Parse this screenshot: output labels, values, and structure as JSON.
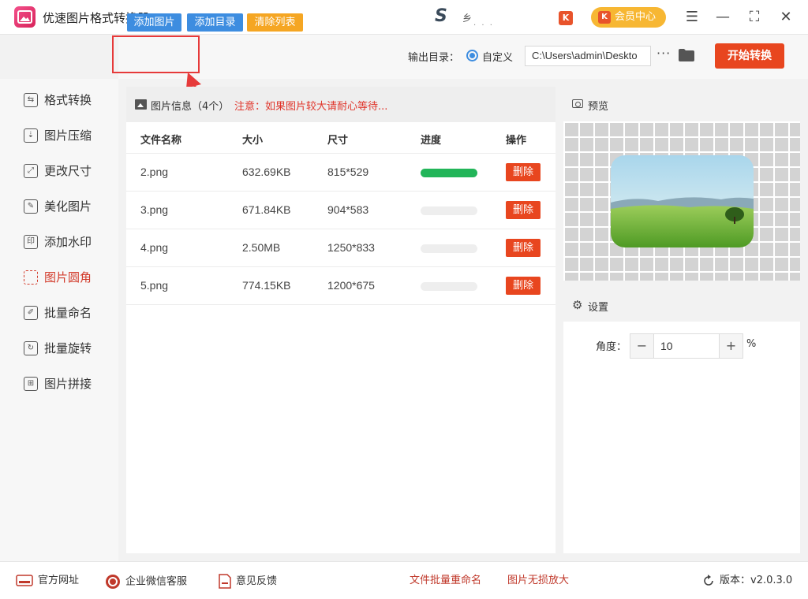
{
  "app": {
    "title": "优速图片格式转换器",
    "brand_sub": "乡",
    "member_label": "会员中心",
    "k_badge": "K"
  },
  "window": {
    "menu": "☰",
    "minimize": "—",
    "maximize": "⛶",
    "close": "✕"
  },
  "toolbar": {
    "add_image": "添加图片",
    "add_folder": "添加目录",
    "clear_list": "清除列表",
    "output_label": "输出目录：",
    "custom_label": "自定义",
    "output_path": "C:\\Users\\admin\\Deskto",
    "more": "···",
    "start_button": "开始转换"
  },
  "sidebar": {
    "items": [
      {
        "label": "格式转换",
        "icon": "format-icon",
        "glyph": "⇆",
        "active": false
      },
      {
        "label": "图片压缩",
        "icon": "compress-icon",
        "glyph": "⇣",
        "active": false
      },
      {
        "label": "更改尺寸",
        "icon": "resize-icon",
        "glyph": "⤢",
        "active": false
      },
      {
        "label": "美化图片",
        "icon": "beautify-icon",
        "glyph": "✎",
        "active": false
      },
      {
        "label": "添加水印",
        "icon": "watermark-icon",
        "glyph": "印",
        "active": false
      },
      {
        "label": "图片圆角",
        "icon": "rounded-corner-icon",
        "glyph": "",
        "active": true
      },
      {
        "label": "批量命名",
        "icon": "rename-icon",
        "glyph": "✐",
        "active": false
      },
      {
        "label": "批量旋转",
        "icon": "rotate-icon",
        "glyph": "↻",
        "active": false
      },
      {
        "label": "图片拼接",
        "icon": "stitch-icon",
        "glyph": "⊞",
        "active": false
      }
    ]
  },
  "file_list": {
    "info_label": "图片信息（4个）",
    "notice": "注意：如果图片较大请耐心等待...",
    "columns": [
      "文件名称",
      "大小",
      "尺寸",
      "进度",
      "操作"
    ],
    "delete_label": "删除",
    "rows": [
      {
        "name": "2.png",
        "size": "632.69KB",
        "dimensions": "815*529",
        "progress": 1.0
      },
      {
        "name": "3.png",
        "size": "671.84KB",
        "dimensions": "904*583",
        "progress": 0
      },
      {
        "name": "4.png",
        "size": "2.50MB",
        "dimensions": "1250*833",
        "progress": 0
      },
      {
        "name": "5.png",
        "size": "774.15KB",
        "dimensions": "1200*675",
        "progress": 0
      }
    ]
  },
  "preview": {
    "label": "预览"
  },
  "settings": {
    "label": "设置",
    "angle_label": "角度：",
    "angle_value": "10",
    "minus": "−",
    "plus": "+",
    "unit": "%"
  },
  "footer": {
    "website": "官方网址",
    "wechat": "企业微信客服",
    "feedback": "意见反馈",
    "batch_rename": "文件批量重命名",
    "lossless": "图片无损放大",
    "version_label": "版本：",
    "version": "v2.0.3.0"
  },
  "colors": {
    "accent_blue": "#3d8de0",
    "accent_orange": "#f5a623",
    "danger": "#e8461f",
    "progress": "#22b559"
  }
}
